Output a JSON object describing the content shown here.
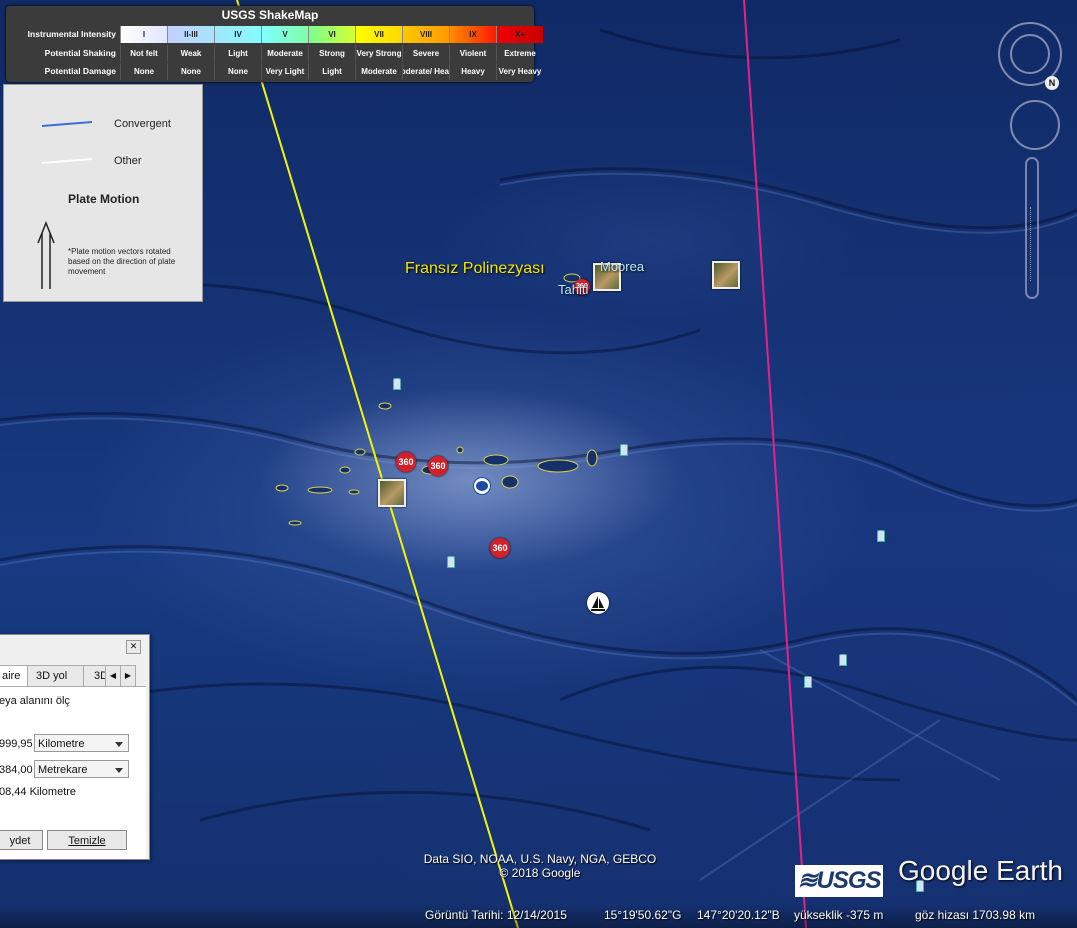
{
  "shakemap": {
    "title": "USGS ShakeMap",
    "row_labels": [
      "Instrumental Intensity",
      "Potential Shaking",
      "Potential Damage"
    ],
    "intensity": [
      "I",
      "II-III",
      "IV",
      "V",
      "VI",
      "VII",
      "VIII",
      "IX",
      "X+"
    ],
    "shaking": [
      "Not felt",
      "Weak",
      "Light",
      "Moderate",
      "Strong",
      "Very Strong",
      "Severe",
      "Violent",
      "Extreme"
    ],
    "damage": [
      "None",
      "None",
      "None",
      "Very Light",
      "Light",
      "Moderate",
      "Moderate/ Heavy",
      "Heavy",
      "Very Heavy"
    ],
    "intensity_colors": [
      "#ffffff",
      "#bfccff",
      "#a0e6ff",
      "#80ffff",
      "#7aff93",
      "#ffff00",
      "#ffc800",
      "#ff9100",
      "#ff0000",
      "#c80000"
    ]
  },
  "plate_legend": {
    "convergent": "Convergent",
    "other": "Other",
    "motion_header": "Plate Motion",
    "note": "*Plate motion vectors rotated based on the direction of plate movement",
    "colors": {
      "convergent": "#3a6fd8",
      "other": "#ffffff"
    }
  },
  "map_labels": {
    "region": "Fransız Polinezyası",
    "moorea": "Moorea",
    "tahiti": "Tahiti",
    "badge": "360"
  },
  "measure": {
    "tabs": [
      "aire",
      "3D yol",
      "3D"
    ],
    "desc": "eya alanını ölç",
    "perimeter_value": "999,95",
    "perimeter_unit": "Kilometre",
    "area_value": "384,00",
    "area_unit": "Metrekare",
    "third_value": "08,44 Kilometre",
    "save": "ydet",
    "clear": "Temizle"
  },
  "credits": {
    "line1": "Data SIO, NOAA, U.S. Navy, NGA, GEBCO",
    "line2": "© 2018 Google",
    "usgs": "≋USGS",
    "google_earth": "Google Earth"
  },
  "status": {
    "imagery_date": "Görüntü Tarihi: 12/14/2015",
    "lat": "15°19'50.62\"G",
    "lon": "147°20'20.12\"B",
    "elevation": "yükseklik  -375 m",
    "eye_alt": "göz hizası 1703.98 km"
  },
  "nav": {
    "north": "N"
  }
}
